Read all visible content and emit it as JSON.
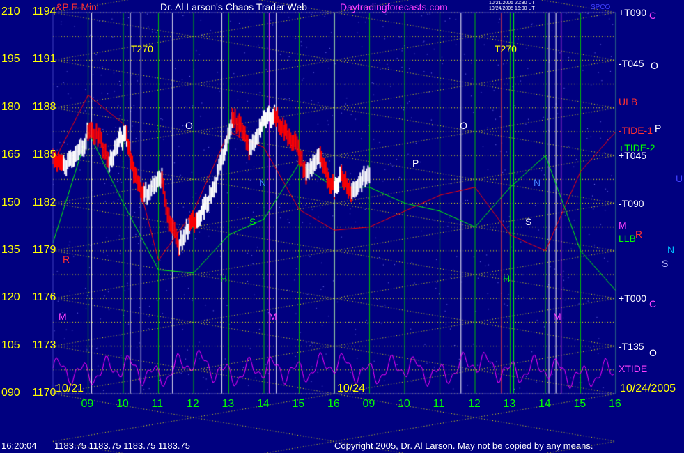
{
  "header": {
    "symbol": "&P E-Mini",
    "title": "Dr. Al Larson's Chaos Trader Web",
    "site": "Daytradingforecasts.com",
    "stamp_line1": "10/21/2005 20:30 UT",
    "stamp_line2": "10/24/2005 16:00 UT",
    "spcode": "SPCO"
  },
  "status": {
    "time": "16:20:04",
    "ohlc": "1183.75 1183.75 1183.75 1183.75",
    "copyright": "Copyright 2005, Dr. Al Larson. May not be copied by any means."
  },
  "colors": {
    "background": "#000080",
    "price_up": "#ffffff",
    "price_down": "#ff0000",
    "grid_yellow": "#ffff00",
    "grid_green": "#00c000",
    "tide_red": "#ff0000",
    "tide_green": "#00ff00",
    "xtide": "#ff00ff"
  },
  "chart_data": {
    "type": "line",
    "title": "S&P E-Mini",
    "y_left_scale_label": [
      "210",
      "195",
      "180",
      "165",
      "150",
      "135",
      "120",
      "105",
      "090"
    ],
    "y_price_ticks": [
      1194,
      1191,
      1188,
      1185,
      1182,
      1179,
      1176,
      1173,
      1170
    ],
    "ylim": [
      1170,
      1194
    ],
    "date_labels": [
      "10/21",
      "10/24",
      "10/24/2005"
    ],
    "x_tick_labels": [
      "09",
      "10",
      "11",
      "12",
      "13",
      "14",
      "15",
      "16",
      "09",
      "10",
      "11",
      "12",
      "13",
      "14",
      "15",
      "16"
    ],
    "right_labels": [
      {
        "text": "+T090",
        "price": 1194
      },
      {
        "text": "-T045",
        "price": 1190.8
      },
      {
        "text": "ULB",
        "price": 1188.4
      },
      {
        "text": "-TIDE-1",
        "price": 1186.6
      },
      {
        "text": "+TIDE-2",
        "price": 1185.5
      },
      {
        "text": "+T045",
        "price": 1185.0
      },
      {
        "text": "-T090",
        "price": 1182.0
      },
      {
        "text": "M",
        "price": 1180.6
      },
      {
        "text": "LLB",
        "price": 1179.8
      },
      {
        "text": "+T000",
        "price": 1176.0
      },
      {
        "text": "-T135",
        "price": 1173.0
      },
      {
        "text": "XTIDE",
        "price": 1171.6
      }
    ],
    "far_right_labels": [
      "C",
      "O",
      "P",
      "U",
      "R",
      "N",
      "S",
      "C",
      "O"
    ],
    "chart_annotations": [
      "T270",
      "T270",
      "O",
      "O",
      "P",
      "N",
      "N",
      "S",
      "S",
      "H",
      "H",
      "M",
      "M",
      "M",
      "R"
    ],
    "series": [
      {
        "name": "Price",
        "x": [
          0.0,
          0.3,
          0.6,
          0.9,
          1.0,
          1.3,
          1.6,
          1.9,
          2.1,
          2.3,
          2.6,
          2.9,
          3.1,
          3.3,
          3.6,
          3.9,
          4.1,
          4.3,
          4.6,
          4.9,
          5.1,
          5.3,
          5.6,
          5.9,
          6.1,
          6.3,
          6.6,
          6.9,
          7.0,
          7.2,
          7.4,
          7.6,
          7.8,
          8.0,
          8.2,
          8.5,
          8.8,
          9.0
        ],
        "values": [
          1185.0,
          1184.3,
          1184.8,
          1185.8,
          1186.5,
          1186.3,
          1184.5,
          1186.0,
          1186.2,
          1184.0,
          1182.5,
          1183.2,
          1183.5,
          1181.0,
          1179.3,
          1180.8,
          1180.7,
          1181.7,
          1183.0,
          1185.6,
          1187.4,
          1186.9,
          1185.3,
          1186.8,
          1187.4,
          1187.6,
          1186.5,
          1185.8,
          1185.1,
          1183.8,
          1184.5,
          1184.8,
          1183.6,
          1183.0,
          1183.8,
          1182.7,
          1183.5,
          1183.8
        ]
      },
      {
        "name": "ULB",
        "x": [
          0,
          1,
          2,
          3,
          4,
          5,
          6,
          7,
          8,
          9,
          10,
          11,
          12,
          13,
          14,
          15,
          16
        ],
        "values": [
          1184.5,
          1188.8,
          1187.0,
          1178.4,
          1181.5,
          1186.5,
          1185.5,
          1181.6,
          1180.3,
          1180.5,
          1181.5,
          1182.5,
          1183.0,
          1180.0,
          1179.0,
          1184.0,
          1186.5
        ]
      },
      {
        "name": "Tide",
        "x": [
          0,
          1,
          2,
          3,
          4,
          5,
          6,
          7,
          8,
          9,
          10,
          11,
          12,
          13,
          14,
          15,
          16
        ],
        "values": [
          1179.5,
          1186.5,
          1182.0,
          1177.8,
          1177.6,
          1180.0,
          1181.0,
          1184.5,
          1183.0,
          1183.0,
          1182.0,
          1181.5,
          1180.5,
          1183.0,
          1185.0,
          1179.0,
          1176.5
        ]
      },
      {
        "name": "XTIDE",
        "x": [
          0,
          1,
          2,
          3,
          4,
          5,
          6,
          7,
          8,
          9,
          10,
          11,
          12,
          13,
          14,
          15,
          16
        ],
        "values": [
          1171.6,
          1171.2,
          1171.8,
          1171.0,
          1172.2,
          1171.1,
          1171.7,
          1171.3,
          1172.0,
          1171.2,
          1171.8,
          1171.1,
          1172.1,
          1171.3,
          1171.7,
          1171.0,
          1171.5
        ]
      }
    ],
    "grid": true
  }
}
